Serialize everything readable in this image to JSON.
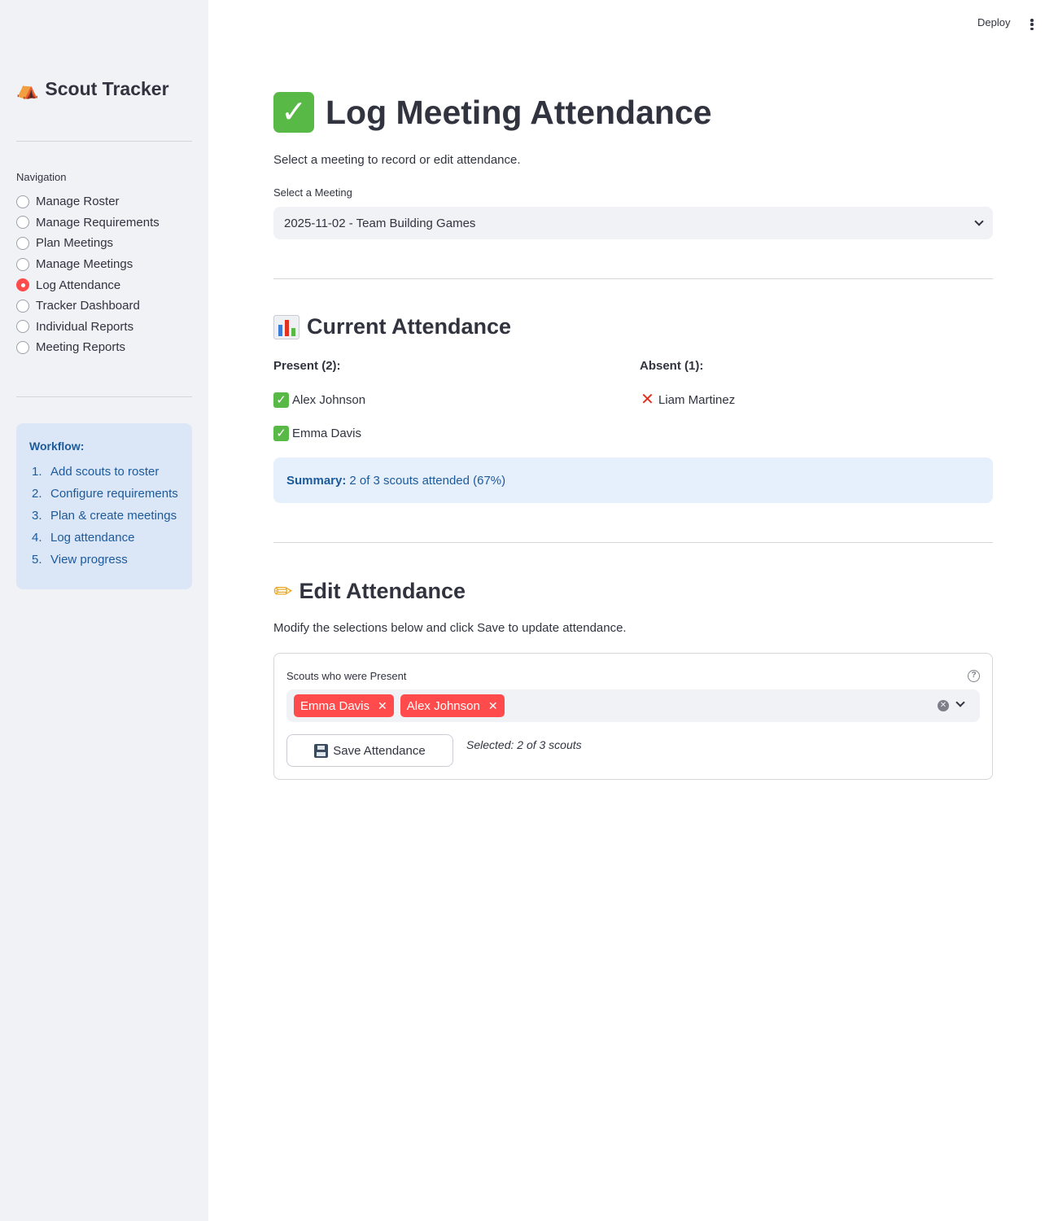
{
  "sidebar": {
    "app_title": "Scout Tracker",
    "app_icon": "camping-tent-icon",
    "nav_heading": "Navigation",
    "nav_items": [
      {
        "label": "Manage Roster",
        "selected": false
      },
      {
        "label": "Manage Requirements",
        "selected": false
      },
      {
        "label": "Plan Meetings",
        "selected": false
      },
      {
        "label": "Manage Meetings",
        "selected": false
      },
      {
        "label": "Log Attendance",
        "selected": true
      },
      {
        "label": "Tracker Dashboard",
        "selected": false
      },
      {
        "label": "Individual Reports",
        "selected": false
      },
      {
        "label": "Meeting Reports",
        "selected": false
      }
    ],
    "workflow": {
      "title": "Workflow:",
      "steps": [
        {
          "num": "1.",
          "label": "Add scouts to roster"
        },
        {
          "num": "2.",
          "label": "Configure requirements"
        },
        {
          "num": "3.",
          "label": "Plan & create meetings"
        },
        {
          "num": "4.",
          "label": "Log attendance"
        },
        {
          "num": "5.",
          "label": "View progress"
        }
      ]
    }
  },
  "topbar": {
    "deploy_label": "Deploy"
  },
  "main": {
    "title": "Log Meeting Attendance",
    "subtitle": "Select a meeting to record or edit attendance.",
    "meeting_select": {
      "label": "Select a Meeting",
      "value": "2025-11-02 - Team Building Games"
    },
    "current": {
      "heading": "Current Attendance",
      "present_heading": "Present (2):",
      "absent_heading": "Absent (1):",
      "present": [
        "Alex Johnson",
        "Emma Davis"
      ],
      "absent": [
        "Liam Martinez"
      ],
      "summary_label": "Summary:",
      "summary_text": "2 of 3 scouts attended (67%)"
    },
    "edit": {
      "heading": "Edit Attendance",
      "description": "Modify the selections below and click Save to update attendance.",
      "multiselect_label": "Scouts who were Present",
      "selected_tags": [
        "Emma Davis",
        "Alex Johnson"
      ],
      "save_label": "Save Attendance",
      "selected_note": "Selected: 2 of 3 scouts"
    }
  },
  "colors": {
    "accent": "#ff4b4b",
    "sidebar_bg": "#f0f2f6",
    "info_bg": "#e6f0fc",
    "info_text": "#1c5a9c"
  }
}
